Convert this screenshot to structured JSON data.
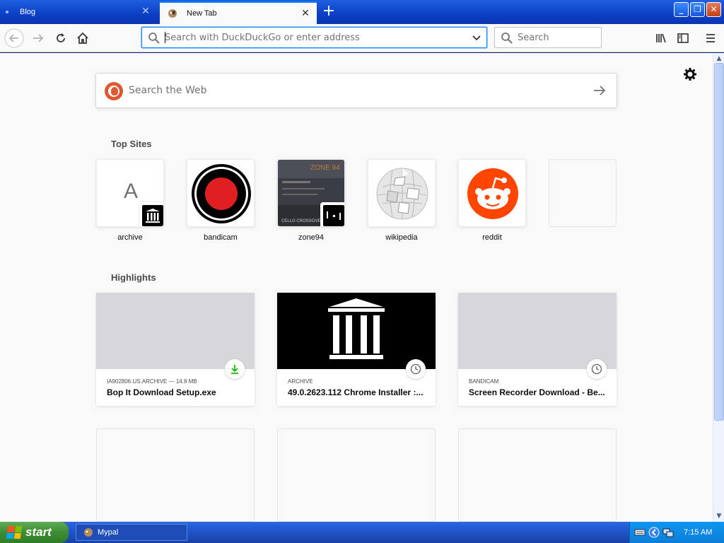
{
  "tabs": [
    {
      "label": "Blog",
      "active": false
    },
    {
      "label": "New Tab",
      "active": true
    }
  ],
  "toolbar": {
    "url_placeholder": "Search with DuckDuckGo or enter address",
    "search_placeholder": "Search"
  },
  "newtab": {
    "web_search_placeholder": "Search the Web",
    "top_sites_title": "Top Sites",
    "highlights_title": "Highlights",
    "top_sites": [
      {
        "label": "archive",
        "letter": "A"
      },
      {
        "label": "bandicam"
      },
      {
        "label": "zone94",
        "thumb_text_top": "ZONE 94",
        "thumb_text_bottom": "CELLO CROSSOVER METAL"
      },
      {
        "label": "wikipedia"
      },
      {
        "label": "reddit"
      }
    ],
    "highlights": [
      {
        "context": "IA902806.US.ARCHIVE — 14.8 MB",
        "title": "Bop It Download Setup.exe",
        "badge": "download-icon"
      },
      {
        "context": "ARCHIVE",
        "title": "49.0.2623.112 Chrome Installer :...",
        "badge": "clock-icon"
      },
      {
        "context": "BANDICAM",
        "title": "Screen Recorder Download - Be...",
        "badge": "clock-icon"
      }
    ]
  },
  "taskbar": {
    "start_label": "start",
    "task_label": "Mypal",
    "clock": "7:15 AM"
  },
  "colors": {
    "accent": "#0a84ff",
    "xp_taskbar": "#245edb",
    "start_green": "#3c8d32",
    "reddit": "#ff4500",
    "bandicam": "#e02020"
  }
}
